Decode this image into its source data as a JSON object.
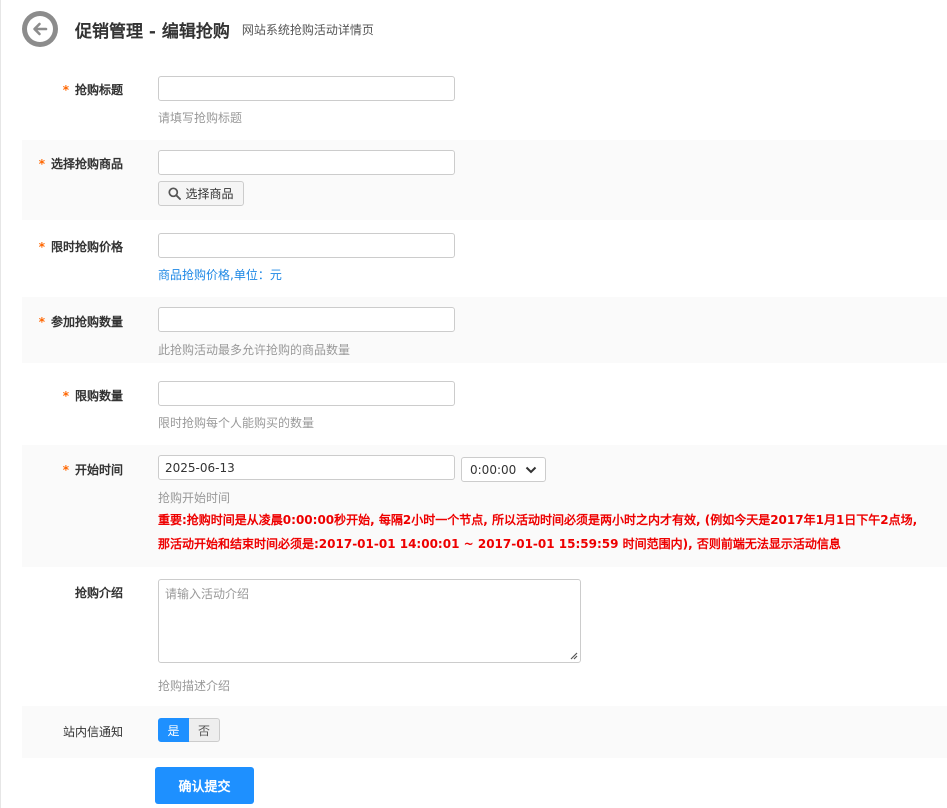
{
  "header": {
    "title": "促销管理 - 编辑抢购",
    "subtitle": "网站系统抢购活动详情页",
    "back_icon": "back-arrow-icon"
  },
  "form": {
    "title_field": {
      "label": "抢购标题",
      "value": "",
      "hint": "请填写抢购标题"
    },
    "product_field": {
      "label": "选择抢购商品",
      "value": "",
      "button_label": "选择商品",
      "button_icon": "search-icon"
    },
    "price_field": {
      "label": "限时抢购价格",
      "value": "",
      "hint": "商品抢购价格,单位：元"
    },
    "quantity_field": {
      "label": "参加抢购数量",
      "value": "",
      "hint": "此抢购活动最多允许抢购的商品数量"
    },
    "limit_field": {
      "label": "限购数量",
      "value": "",
      "hint": "限时抢购每个人能购买的数量"
    },
    "start_time_field": {
      "label": "开始时间",
      "date_value": "2025-06-13",
      "time_value": "0:00:00",
      "hint": "抢购开始时间",
      "warning_line1": "重要:抢购时间是从凌晨0:00:00秒开始, 每隔2小时一个节点, 所以活动时间必须是两小时之内才有效, (例如今天是2017年1月1日下午2点场,",
      "warning_line2": "那活动开始和结束时间必须是:2017-01-01 14:00:01 ~ 2017-01-01 15:59:59 时间范围内), 否则前端无法显示活动信息"
    },
    "intro_field": {
      "label": "抢购介绍",
      "placeholder": "请输入活动介绍",
      "hint": "抢购描述介绍"
    },
    "notify_field": {
      "label": "站内信通知",
      "yes_label": "是",
      "no_label": "否",
      "selected": "是"
    },
    "submit_label": "确认提交"
  },
  "colors": {
    "required_star": "#ff6600",
    "accent": "#1e90ff",
    "warning": "#ee0000",
    "hint_blue": "#1e88e5"
  }
}
